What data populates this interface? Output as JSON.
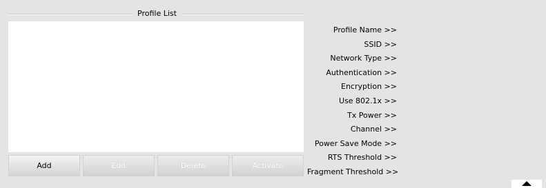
{
  "profile_list": {
    "title": "Profile List",
    "items": []
  },
  "buttons": {
    "add": "Add",
    "edit": "Edit",
    "delete": "Delete",
    "activate": "Activate"
  },
  "details": {
    "labels": [
      "Profile Name >>",
      "SSID >>",
      "Network Type >>",
      "Authentication >>",
      "Encryption >>",
      "Use 802.1x >>",
      "Tx Power >>",
      "Channel >>",
      "Power Save Mode >>",
      "RTS Threshold >>",
      "Fragment Threshold >>"
    ]
  },
  "icons": {
    "collapse": "chevron-up-icon"
  },
  "colors": {
    "background": "#e4e4e4",
    "list_background": "#ffffff",
    "disabled_text": "#ffffff"
  }
}
